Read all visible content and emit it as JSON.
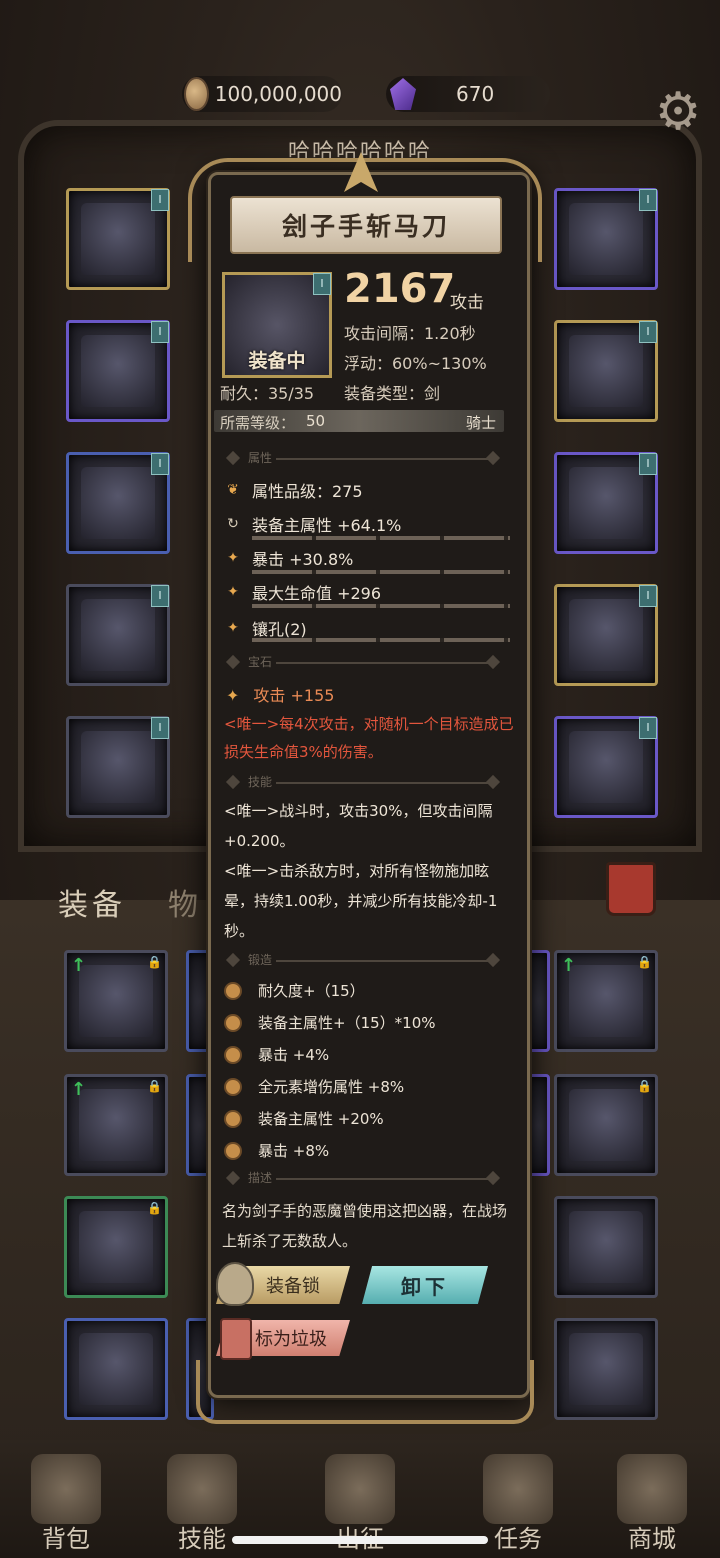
{
  "currency": {
    "gold": "100,000,000",
    "gems": "670"
  },
  "player_name": "哈哈哈哈哈哈",
  "tabs": {
    "equip": "装备",
    "items": "物"
  },
  "item": {
    "name": "刽子手斩马刀",
    "status": "装备中",
    "attack": "2167",
    "attack_label": "攻击",
    "interval": "攻击间隔：1.20秒",
    "float": "浮动：60%~130%",
    "durability": "耐久：35/35",
    "type": "装备类型：剑",
    "req_label": "所需等级：",
    "req_level": "50",
    "req_class": "骑士"
  },
  "sections": {
    "attributes": "属性",
    "gems": "宝石",
    "skills": "技能",
    "forge": "锻造",
    "description": "描述"
  },
  "attributes": [
    "属性品级：275",
    "装备主属性 +64.1%",
    "暴击 +30.8%",
    "最大生命值 +296",
    "镶孔(2)"
  ],
  "gem_stat": "攻击 +155",
  "unique_effect": "<唯一>每4次攻击，对随机一个目标造成已损失生命值3%的伤害。",
  "skills": [
    "<唯一>战斗时，攻击30%，但攻击间隔+0.200。",
    "<唯一>击杀敌方时，对所有怪物施加眩晕，持续1.00秒，并减少所有技能冷却-1秒。"
  ],
  "forge": [
    "耐久度+（15）",
    "装备主属性+（15）*10%",
    "暴击 +4%",
    "全元素增伤属性 +8%",
    "装备主属性 +20%",
    "暴击 +8%"
  ],
  "description": "名为剑子手的恶魔曾使用这把凶器，在战场上斩杀了无数敌人。",
  "buttons": {
    "lock": "装备锁",
    "unequip": "卸下",
    "mark_trash": "标为垃圾"
  },
  "nav": [
    "背包",
    "技能",
    "出征",
    "任务",
    "商城"
  ],
  "badge": "I"
}
